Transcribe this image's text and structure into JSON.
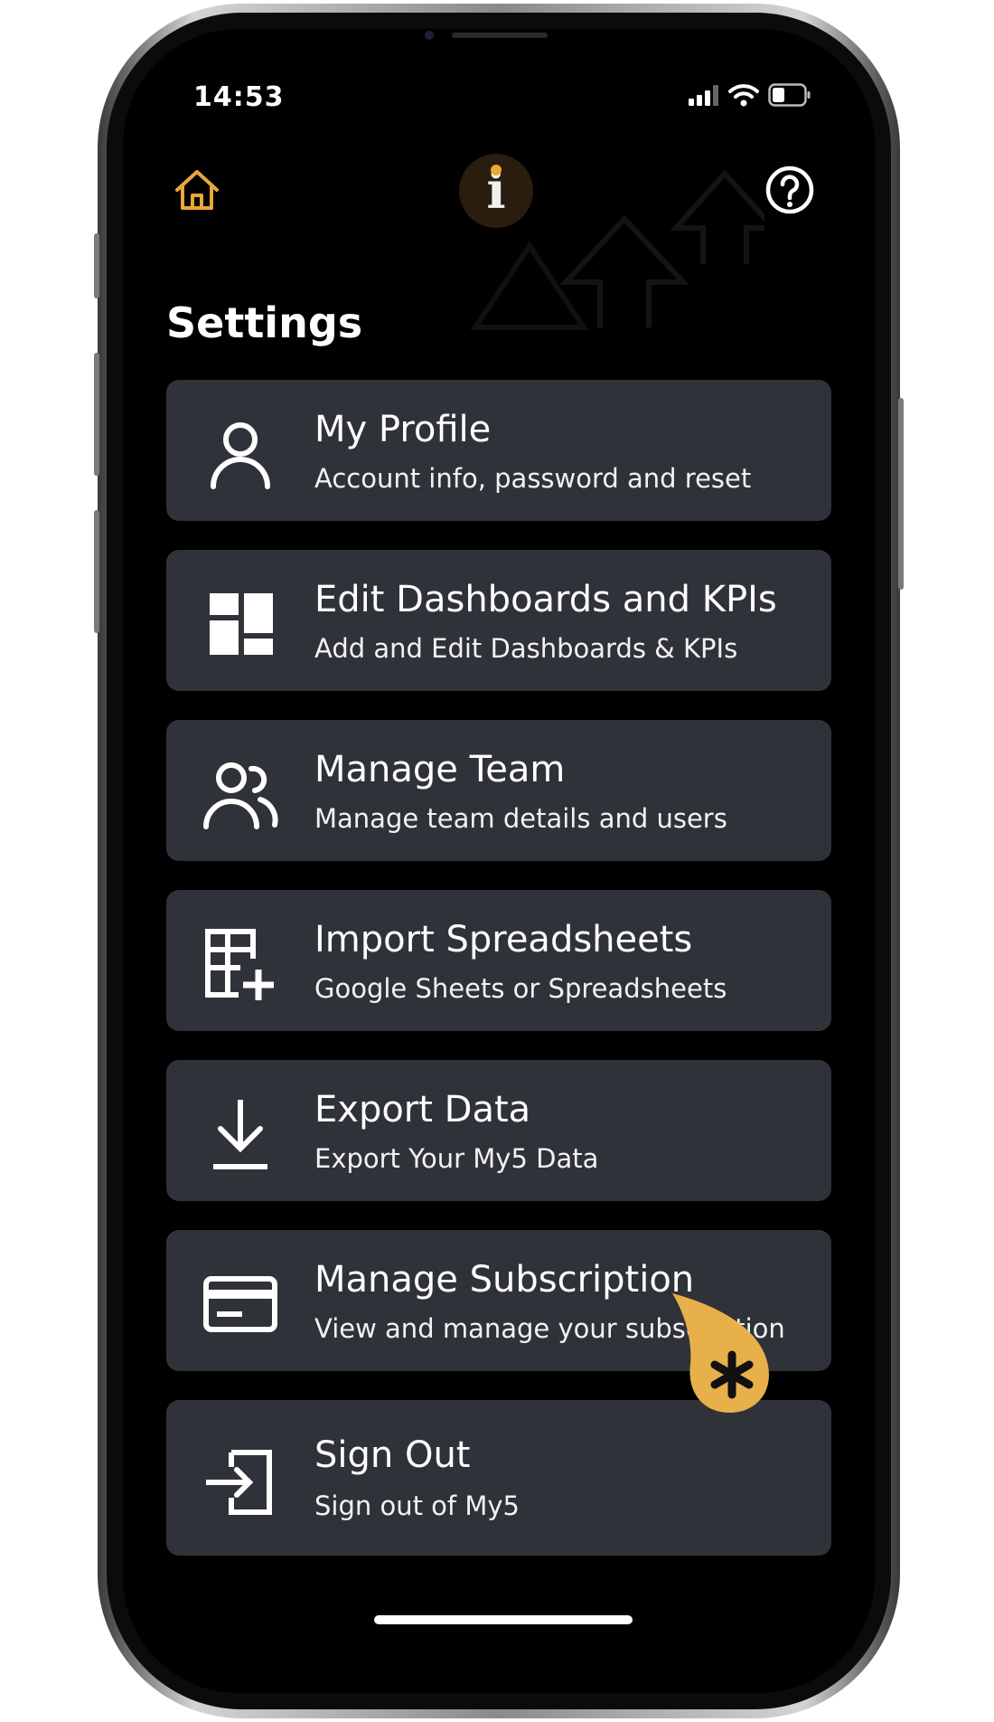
{
  "status": {
    "time": "14:53"
  },
  "topbar": {
    "home_icon": "home-icon",
    "logo_letter": "i",
    "help_icon": "question-circle-icon",
    "accent": "#e8a83a"
  },
  "page_title": "Settings",
  "menu": [
    {
      "icon": "person-icon",
      "title": "My Profile",
      "subtitle": "Account info, password and reset"
    },
    {
      "icon": "dashboard-grid-icon",
      "title": "Edit Dashboards and KPIs",
      "subtitle": "Add and Edit Dashboards & KPIs"
    },
    {
      "icon": "team-icon",
      "title": "Manage Team",
      "subtitle": "Manage team details and users"
    },
    {
      "icon": "spreadsheet-add-icon",
      "title": "Import Spreadsheets",
      "subtitle": "Google Sheets or Spreadsheets"
    },
    {
      "icon": "download-icon",
      "title": "Export Data",
      "subtitle": "Export Your My5 Data"
    },
    {
      "icon": "credit-card-icon",
      "title": "Manage Subscription",
      "subtitle": "View and manage your subscription"
    },
    {
      "icon": "sign-in-icon",
      "title": "Sign Out",
      "subtitle": "Sign out of My5"
    }
  ],
  "colors": {
    "card_bg": "#30323a",
    "screen_bg": "#000000",
    "hint": "#e8b04a"
  }
}
